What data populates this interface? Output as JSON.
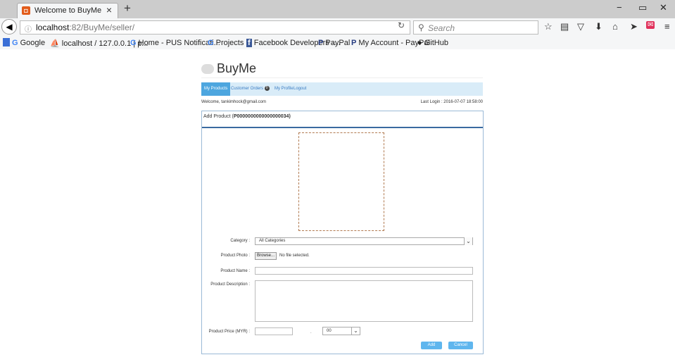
{
  "browser": {
    "tab_title": "Welcome to BuyMe",
    "tab_close": "×",
    "new_tab": "+",
    "url_host": "localhost",
    "url_rest": ":82/BuyMe/seller/",
    "search_placeholder": "Search",
    "window_controls": [
      "−",
      "▭",
      "✕"
    ]
  },
  "bookmarks": [
    {
      "icon": "G",
      "label": "Google"
    },
    {
      "icon": "phpmyadmin",
      "label": "localhost / 127.0.0.1 | p..."
    },
    {
      "icon": "G",
      "label": "Home - PUS Notificati..."
    },
    {
      "icon": "G",
      "label": "Projects"
    },
    {
      "icon": "f",
      "label": "Facebook Developers -..."
    },
    {
      "icon": "P",
      "label": "PayPal"
    },
    {
      "icon": "P",
      "label": "My Account - PayPal"
    },
    {
      "icon": "github",
      "label": "GitHub"
    }
  ],
  "site": {
    "logo_text": "BuyMe",
    "menu": {
      "my_products": "My Products",
      "customer_orders": "Customer Orders",
      "customer_orders_count": "0",
      "my_profile": "My Profile",
      "logout": "Logout"
    },
    "welcome": "Welcome, tankimhock@gmail.com",
    "last_login": "Last Login : 2016-07-07 18:58:00"
  },
  "form": {
    "title_prefix": "Add Product (",
    "product_id": "P0000000000000000034",
    "title_suffix": ")",
    "category_label": "Category :",
    "category_value": "All Categories",
    "photo_label": "Product Photo :",
    "browse_label": "Browse...",
    "no_file": "No file selected.",
    "name_label": "Product Name :",
    "name_value": "",
    "description_label": "Product Description :",
    "description_value": "",
    "price_label": "Product Price (MYR) :",
    "price_value": "",
    "price_separator": ".",
    "cents_value": "00",
    "add_label": "Add",
    "cancel_label": "Cancel"
  },
  "colors": {
    "accent": "#5fb6ee",
    "menu_bg": "#d9ecf8",
    "panel_rule": "#3a6aa0"
  }
}
